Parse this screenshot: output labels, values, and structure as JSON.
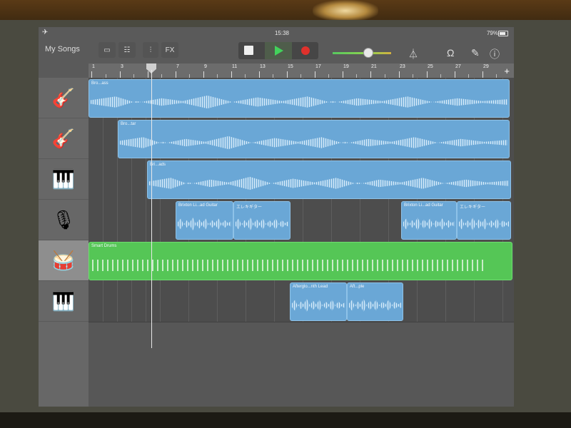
{
  "status": {
    "time": "15:38",
    "battery": "79%"
  },
  "toolbar": {
    "my_songs": "My Songs",
    "fx": "FX",
    "colors": {
      "play": "#42d25b",
      "record": "#e0312c"
    }
  },
  "ruler": {
    "bars": [
      "1",
      "3",
      "5",
      "7",
      "9",
      "11",
      "13",
      "15",
      "17",
      "19",
      "21",
      "23",
      "25",
      "27",
      "29"
    ],
    "add": "+"
  },
  "track_headers": [
    {
      "name": "bass-guitar-icon",
      "glyph": "🎸"
    },
    {
      "name": "electric-guitar-icon",
      "glyph": "🎸"
    },
    {
      "name": "keyboard-synth-icon",
      "glyph": "🎹"
    },
    {
      "name": "microphone-icon",
      "glyph": "🎙"
    },
    {
      "name": "drum-machine-icon",
      "glyph": "🥁"
    },
    {
      "name": "keyboard-synth-icon",
      "glyph": "🎹"
    }
  ],
  "add_track": "+",
  "regions": {
    "r1": "Bro...ass",
    "r2": "Bro...tar",
    "r3": "Bri...ads",
    "r4a": "Brixton Li...ad Guitar",
    "r4b": "エレキギター",
    "r4c": "Brixton Li...ad Guitar",
    "r4d": "エレキギター",
    "r5": "Smart Drums",
    "r6a": "Afterglo...nth Lead",
    "r6b": "Aft...ple"
  }
}
